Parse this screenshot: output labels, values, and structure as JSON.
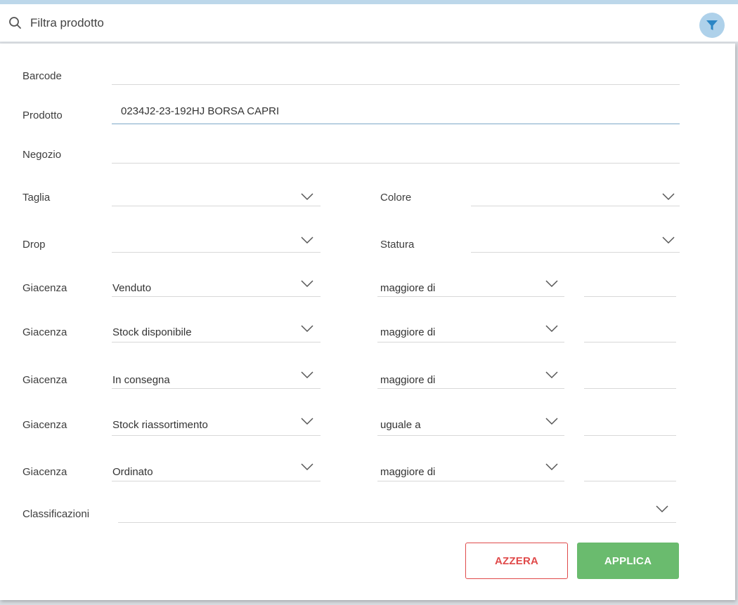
{
  "search": {
    "placeholder": "Filtra prodotto"
  },
  "colors": {
    "accent": "#aed1ea",
    "reset": "#e04a4a",
    "apply": "#6abb6e"
  },
  "form": {
    "barcode": {
      "label": "Barcode",
      "value": ""
    },
    "prodotto": {
      "label": "Prodotto",
      "value": "0234J2-23-192HJ BORSA CAPRI"
    },
    "negozio": {
      "label": "Negozio",
      "value": ""
    },
    "taglia": {
      "label": "Taglia",
      "value": ""
    },
    "colore": {
      "label": "Colore",
      "value": ""
    },
    "drop": {
      "label": "Drop",
      "value": ""
    },
    "statura": {
      "label": "Statura",
      "value": ""
    },
    "giacenza_rows": [
      {
        "label": "Giacenza",
        "type": "Venduto",
        "operator": "maggiore di",
        "value": ""
      },
      {
        "label": "Giacenza",
        "type": "Stock disponibile",
        "operator": "maggiore di",
        "value": ""
      },
      {
        "label": "Giacenza",
        "type": "In consegna",
        "operator": "maggiore di",
        "value": ""
      },
      {
        "label": "Giacenza",
        "type": "Stock riassortimento",
        "operator": "uguale a",
        "value": ""
      },
      {
        "label": "Giacenza",
        "type": "Ordinato",
        "operator": "maggiore di",
        "value": ""
      }
    ],
    "classificazioni": {
      "label": "Classificazioni",
      "value": ""
    }
  },
  "actions": {
    "reset_label": "AZZERA",
    "apply_label": "APPLICA"
  }
}
